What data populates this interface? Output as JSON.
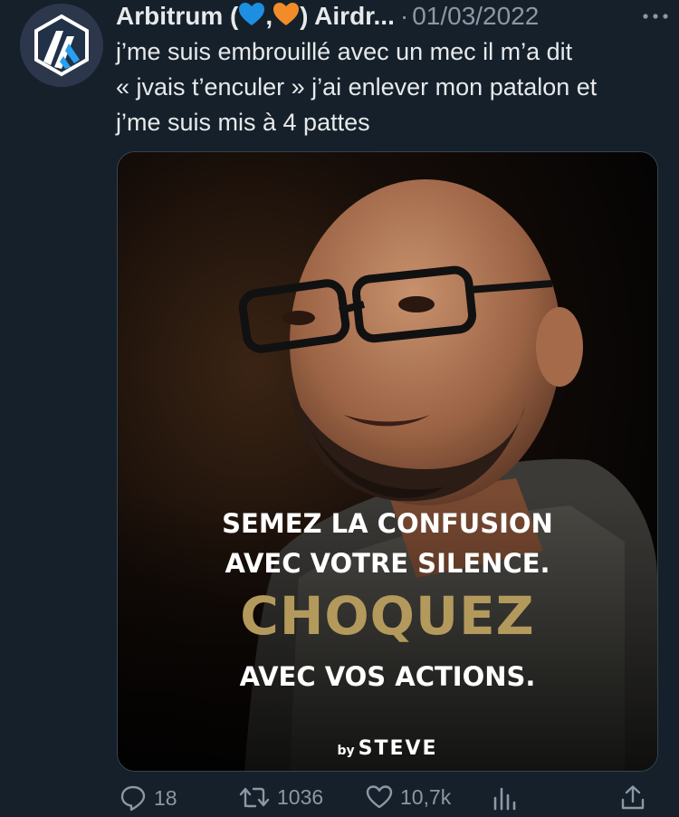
{
  "tweet": {
    "display_name_prefix": "Arbitrum (",
    "display_name_comma": ",",
    "display_name_suffix": ") Airdr...",
    "separator": "·",
    "date": "01/03/2022",
    "text_lines": [
      "j’me suis embrouillé avec un mec il m’a dit",
      "« jvais t’enculer » j’ai enlever mon patalon et",
      "j’me suis mis à 4 pattes"
    ]
  },
  "media": {
    "caption_line1": "SEMEZ LA CONFUSION",
    "caption_line2": "AVEC VOTRE SILENCE.",
    "caption_line3": "CHOQUEZ",
    "caption_line4": "AVEC VOS ACTIONS.",
    "brand_by": "by",
    "brand_name": "STEVE"
  },
  "actions": {
    "replies": "18",
    "retweets": "1036",
    "likes": "10,7k"
  },
  "colors": {
    "background": "#15202b",
    "secondary_text": "#8b98a5",
    "primary_text": "#e7e9ea",
    "heart_blue": "#1d8fe1",
    "heart_orange": "#f28c28",
    "caption_gold": "#b39a5c",
    "avatar_blue": "#28a0f0"
  },
  "icons": [
    "arbitrum-logo-icon",
    "blue-heart-icon",
    "orange-heart-icon",
    "more-icon",
    "reply-icon",
    "retweet-icon",
    "like-icon",
    "views-icon",
    "share-icon"
  ]
}
